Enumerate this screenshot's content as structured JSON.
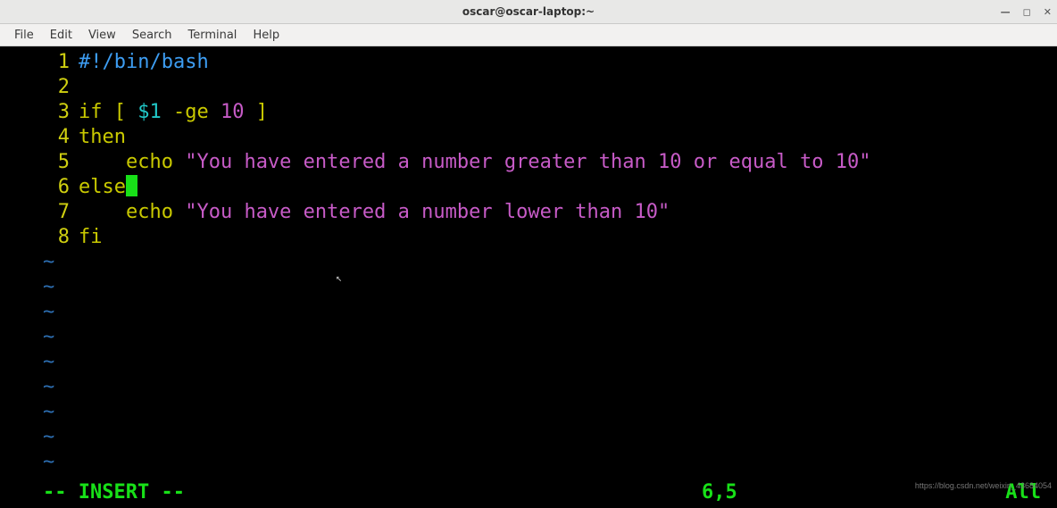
{
  "window": {
    "title": "oscar@oscar-laptop:~",
    "minimize_glyph": "—",
    "maximize_glyph": "◻",
    "close_glyph": "✕"
  },
  "menu": {
    "file": "File",
    "edit": "Edit",
    "view": "View",
    "search": "Search",
    "terminal": "Terminal",
    "help": "Help"
  },
  "code_lines": [
    {
      "n": "1",
      "segments": [
        {
          "cls": "c-comment",
          "t": "#!/bin/bash"
        }
      ]
    },
    {
      "n": "2",
      "segments": []
    },
    {
      "n": "3",
      "segments": [
        {
          "cls": "c-key",
          "t": "if ["
        },
        {
          "cls": "c-plain",
          "t": " "
        },
        {
          "cls": "c-var",
          "t": "$1"
        },
        {
          "cls": "c-plain",
          "t": " "
        },
        {
          "cls": "c-key",
          "t": "-ge"
        },
        {
          "cls": "c-plain",
          "t": " "
        },
        {
          "cls": "c-num",
          "t": "10"
        },
        {
          "cls": "c-plain",
          "t": " "
        },
        {
          "cls": "c-key",
          "t": "]"
        }
      ]
    },
    {
      "n": "4",
      "segments": [
        {
          "cls": "c-key",
          "t": "then"
        }
      ]
    },
    {
      "n": "5",
      "segments": [
        {
          "cls": "c-plain",
          "t": "    "
        },
        {
          "cls": "c-key",
          "t": "echo"
        },
        {
          "cls": "c-plain",
          "t": " "
        },
        {
          "cls": "c-str",
          "t": "\"You have entered a number greater than 10 or equal to 10\""
        }
      ]
    },
    {
      "n": "6",
      "segments": [
        {
          "cls": "c-key",
          "t": "else"
        }
      ],
      "cursor_after": true
    },
    {
      "n": "7",
      "segments": [
        {
          "cls": "c-plain",
          "t": "    "
        },
        {
          "cls": "c-key",
          "t": "echo"
        },
        {
          "cls": "c-plain",
          "t": " "
        },
        {
          "cls": "c-str",
          "t": "\"You have entered a number lower than 10\""
        }
      ]
    },
    {
      "n": "8",
      "segments": [
        {
          "cls": "c-key",
          "t": "fi"
        }
      ]
    }
  ],
  "tilde_count": 9,
  "tilde_glyph": "~",
  "status": {
    "mode": "-- INSERT --",
    "position": "6,5",
    "percent": "All"
  },
  "watermark": "https://blog.csdn.net/weixin_43684054"
}
